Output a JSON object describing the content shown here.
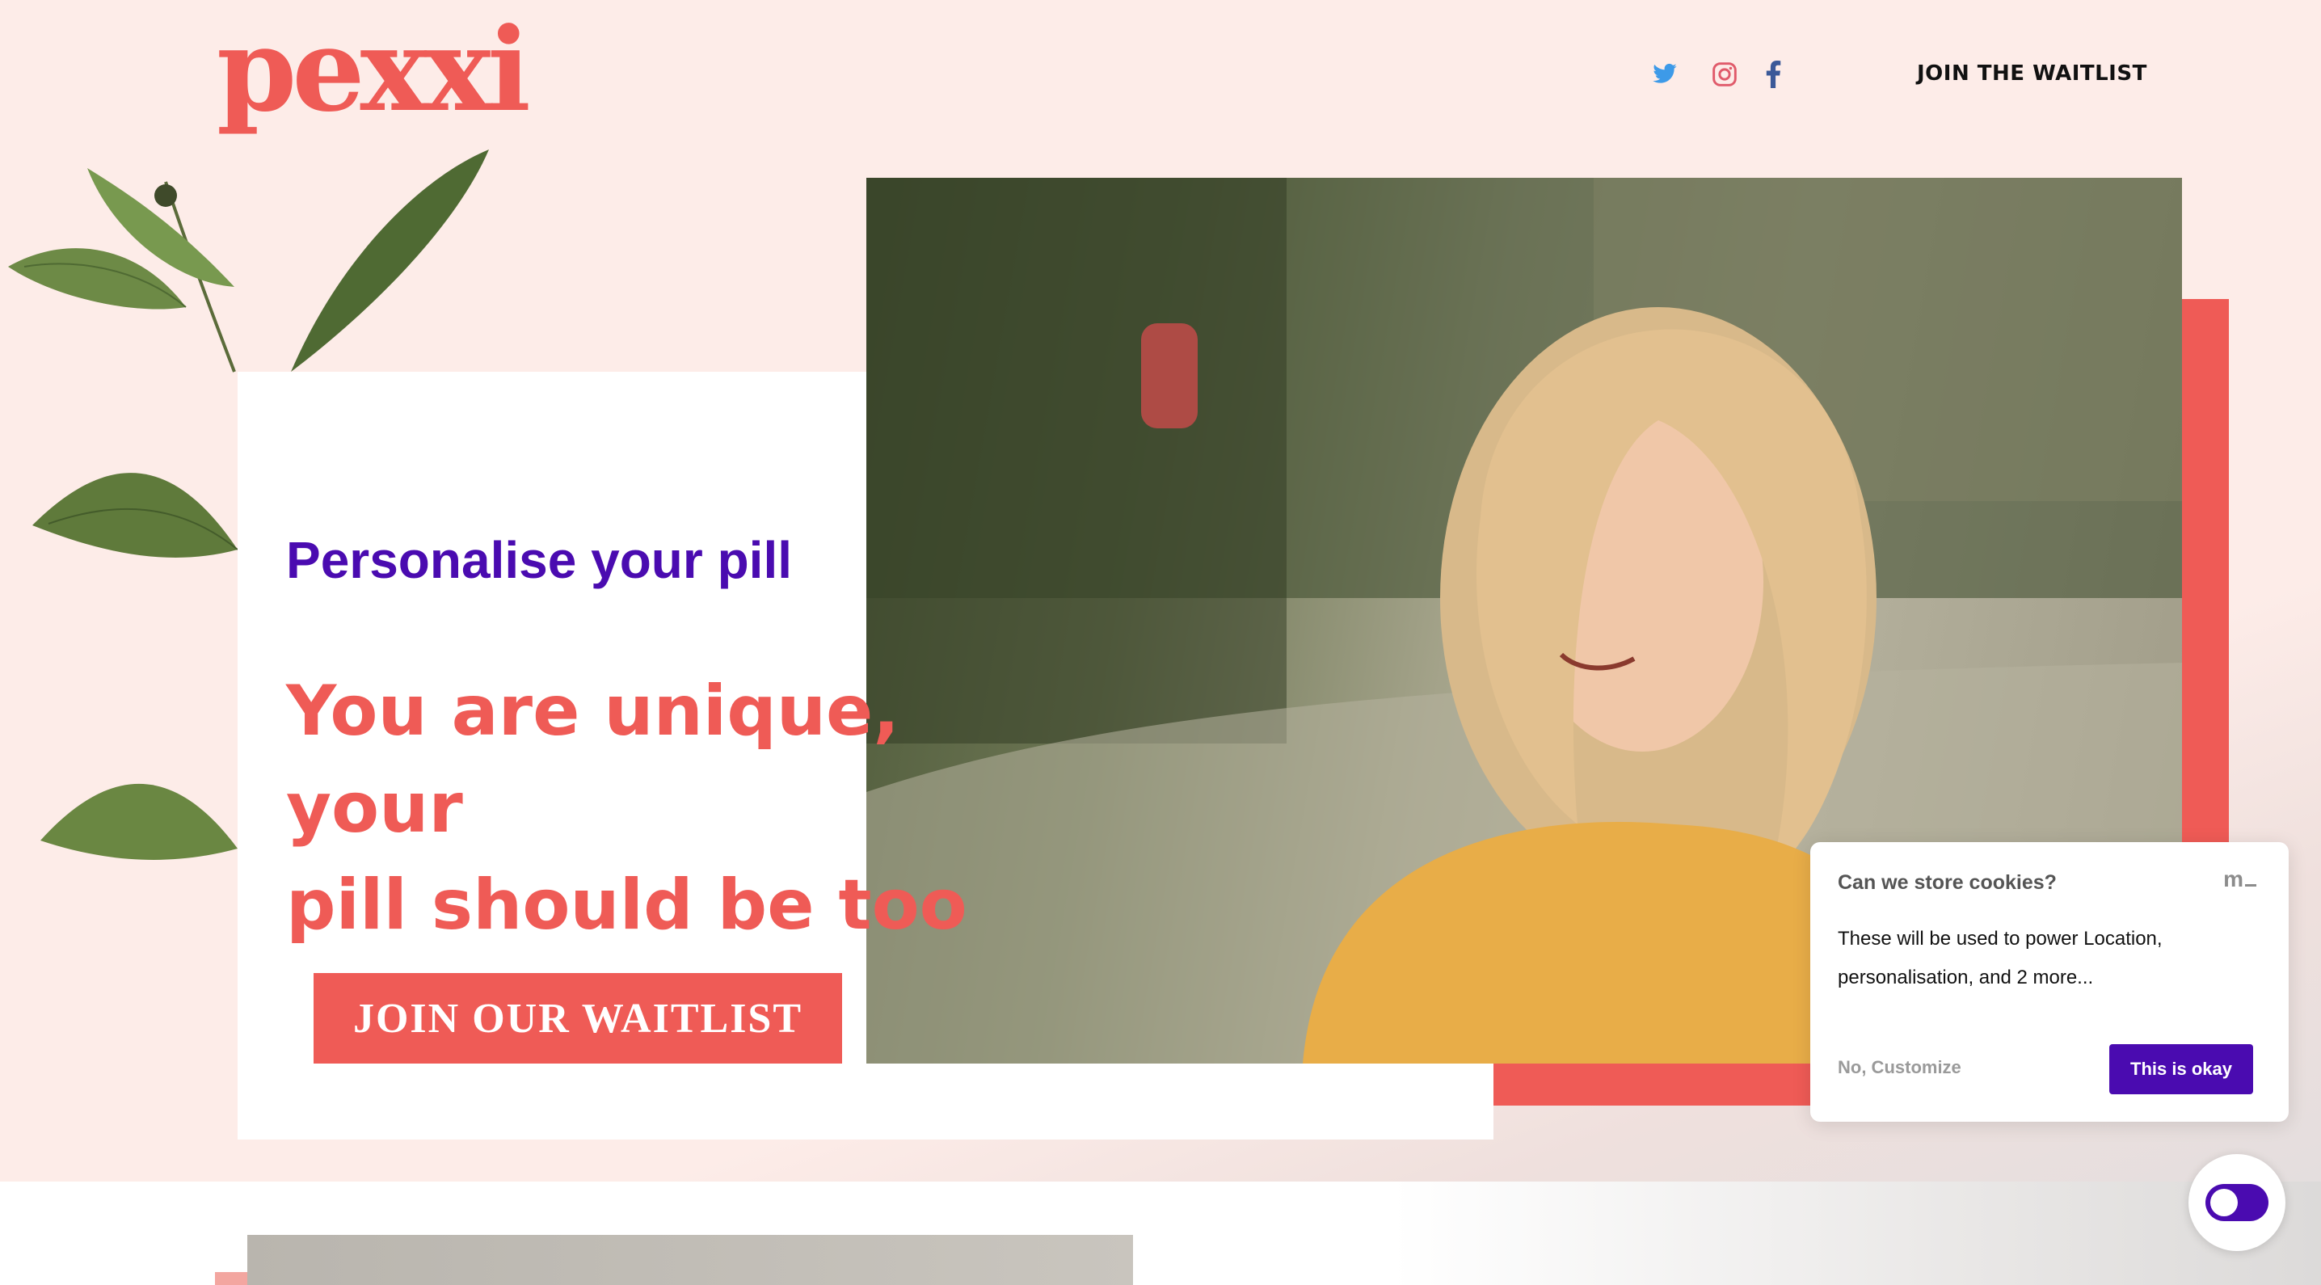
{
  "brand": {
    "logo_text": "pexxi",
    "accent_color": "#ef5b56",
    "purple_color": "#4a0bb0"
  },
  "header": {
    "social": [
      {
        "name": "twitter-icon",
        "color": "#3d9ae8"
      },
      {
        "name": "instagram-icon",
        "color": "#e05a6a"
      },
      {
        "name": "facebook-icon",
        "color": "#3b5998"
      }
    ],
    "nav_join": "JOIN THE WAITLIST"
  },
  "hero": {
    "eyebrow": "Personalise your pill",
    "headline_line1": "You are unique, your",
    "headline_line2": "pill should be too",
    "cta_label": "JOIN OUR WAITLIST",
    "image_alt": "woman-smiling-photo"
  },
  "cookie_banner": {
    "title": "Can we store cookies?",
    "brand_mark": "m",
    "body_line1": "These will be used to power Location,",
    "body_line2": "personalisation, and 2 more...",
    "decline_label": "No, Customize",
    "accept_label": "This is okay"
  },
  "fab": {
    "icon": "toggle-icon"
  }
}
